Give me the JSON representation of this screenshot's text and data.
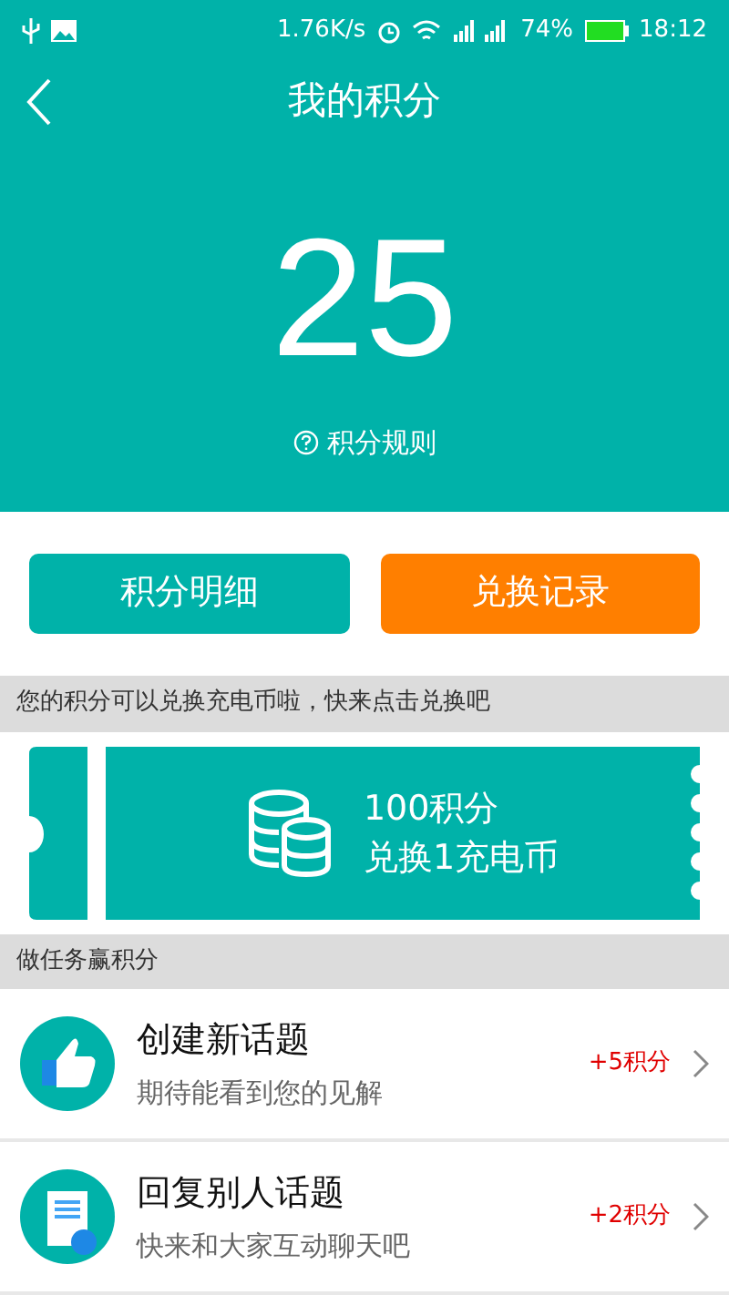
{
  "status_bar": {
    "speed": "1.76K/s",
    "battery": "74%",
    "time": "18:12"
  },
  "header": {
    "title": "我的积分"
  },
  "points": {
    "value": "25",
    "rules_link": "积分规则"
  },
  "buttons": [
    {
      "label": "积分明细",
      "kind": "teal"
    },
    {
      "label": "兑换记录",
      "kind": "orange"
    }
  ],
  "exchange_notice": "您的积分可以兑换充电币啦，快来点击兑换吧",
  "coupon": {
    "line1": "100积分",
    "line2": "兑换1充电币"
  },
  "tasks_header": "做任务赢积分",
  "tasks": [
    {
      "title": "创建新话题",
      "subtitle": "期待能看到您的见解",
      "reward": "+5积分",
      "kind": "thumb"
    },
    {
      "title": "回复别人话题",
      "subtitle": "快来和大家互动聊天吧",
      "reward": "+2积分",
      "kind": "doc"
    }
  ]
}
